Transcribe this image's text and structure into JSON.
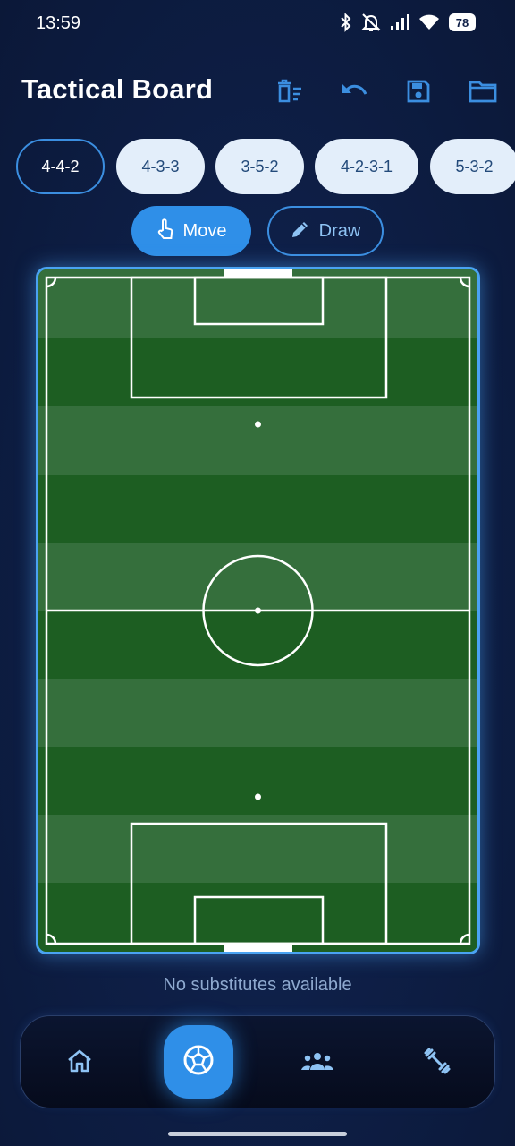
{
  "status_bar": {
    "time": "13:59",
    "battery": "78",
    "icons": [
      "bluetooth-icon",
      "mute-icon",
      "signal-icon",
      "wifi-icon",
      "battery-icon"
    ]
  },
  "header": {
    "title": "Tactical Board",
    "actions": [
      "clear-icon",
      "undo-icon",
      "save-icon",
      "folder-icon"
    ]
  },
  "formations": {
    "selected": "4-4-2",
    "options": [
      "4-4-2",
      "4-3-3",
      "3-5-2",
      "4-2-3-1",
      "5-3-2"
    ]
  },
  "modes": {
    "active": "Move",
    "move_label": "Move",
    "draw_label": "Draw"
  },
  "substitutes": {
    "message": "No substitutes available"
  },
  "bottom_nav": {
    "active": "match",
    "items": [
      "home-icon",
      "soccer-ball-icon",
      "team-icon",
      "training-icon"
    ]
  },
  "colors": {
    "accent": "#2f8fe8",
    "background": "#0e1f47",
    "pitch_dark": "#1d5e22",
    "pitch_light": "#356f3c"
  }
}
